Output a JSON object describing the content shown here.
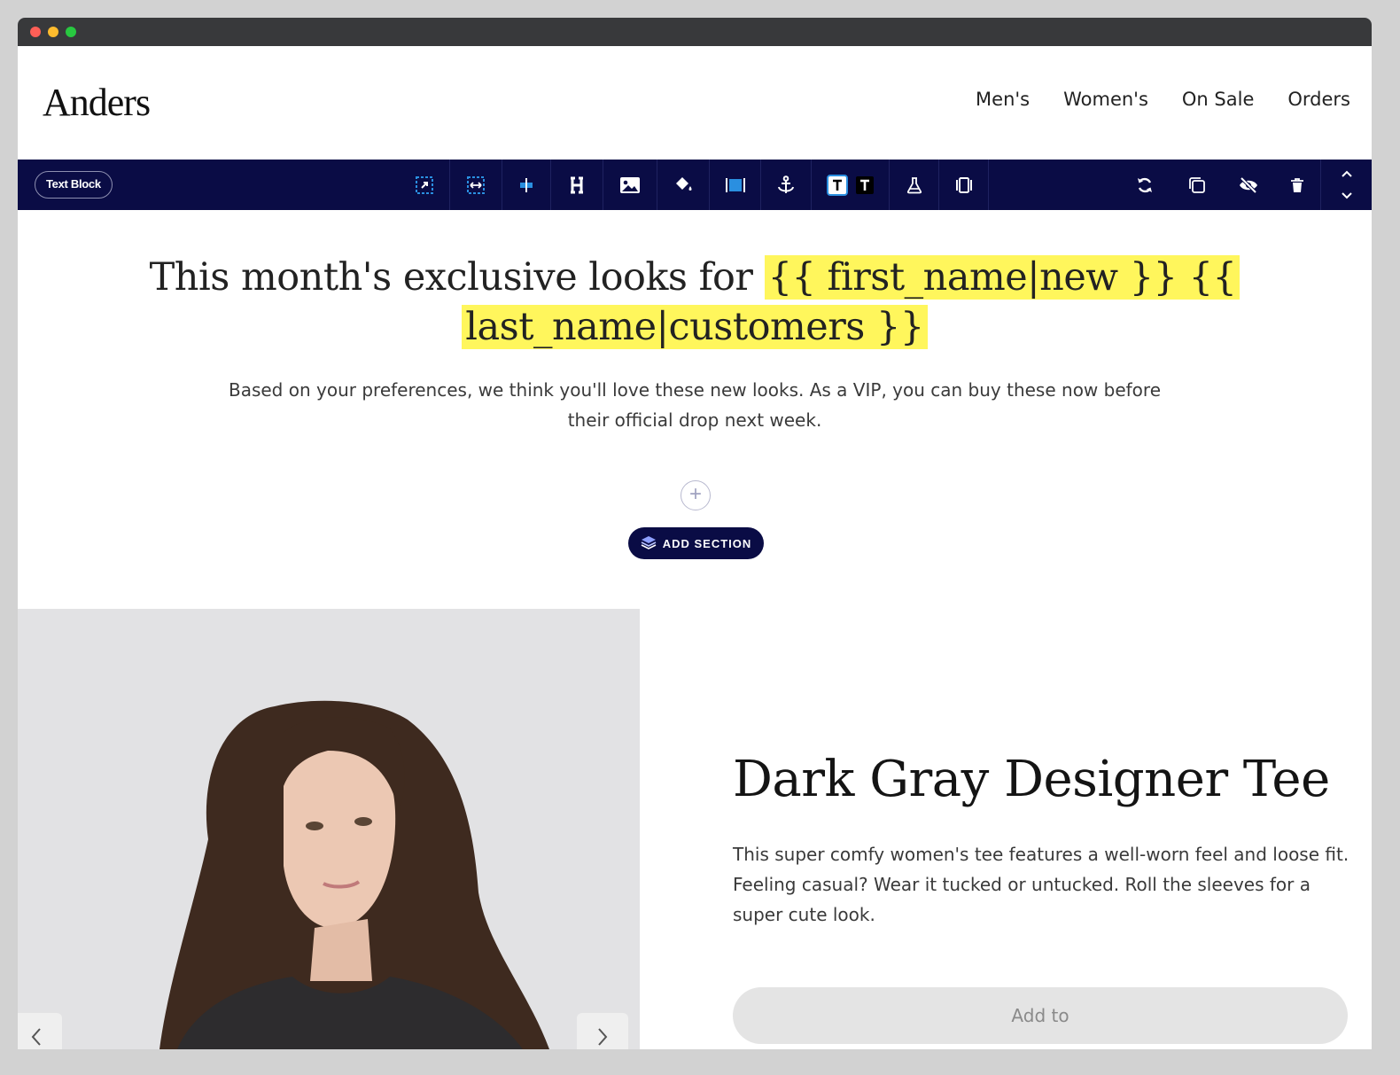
{
  "site": {
    "logo": "Anders",
    "nav": [
      "Men's",
      "Women's",
      "On Sale",
      "Orders"
    ]
  },
  "toolbar": {
    "block_label": "Text Block",
    "buttons": [
      "resize-icon",
      "width-icon",
      "align-center-icon",
      "heading-icon",
      "image-icon",
      "paint-bucket-icon",
      "full-width-icon",
      "anchor-icon",
      "text-style-icon",
      "experiment-icon",
      "spacing-icon"
    ],
    "right_buttons": [
      "refresh-icon",
      "duplicate-icon",
      "hide-icon",
      "delete-icon"
    ],
    "accent_color": "#0a0c45"
  },
  "content": {
    "headline_plain": "This month's exclusive looks for ",
    "headline_merge_1": "{{ first_name|new }} {{",
    "headline_merge_2": "last_name|customers }}",
    "highlight_color": "#fff65c",
    "subtext": "Based on your preferences, we think you'll love these new looks. As a VIP, you can buy these now before their official drop next week.",
    "add_section_label": "ADD SECTION"
  },
  "product": {
    "title": "Dark Gray Designer Tee",
    "description": "This super comfy women's tee features a well-worn feel and loose fit. Feeling casual? Wear it tucked or untucked. Roll the sleeves for a super cute look.",
    "cta_label": "Add to"
  }
}
